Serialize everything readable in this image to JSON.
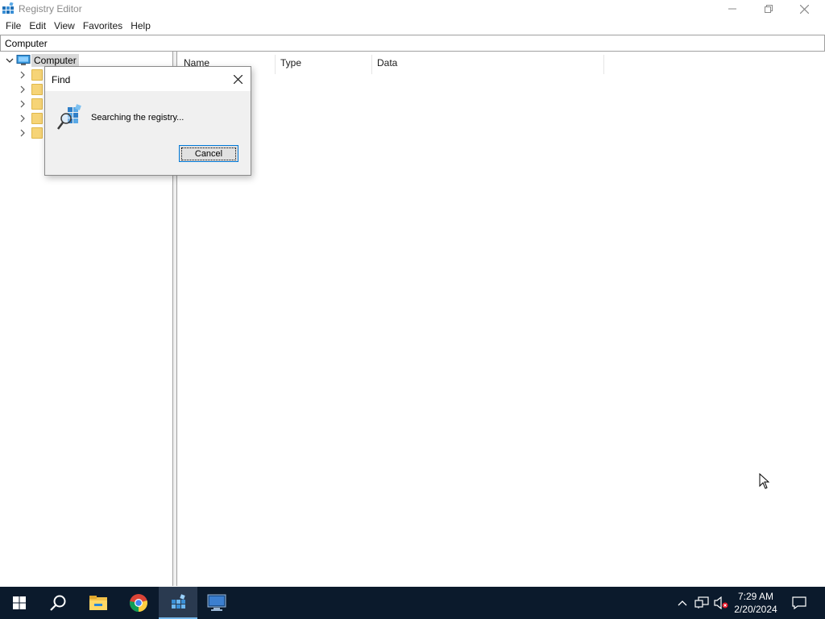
{
  "window": {
    "title": "Registry Editor",
    "icon": "registry-editor-icon"
  },
  "menu": [
    "File",
    "Edit",
    "View",
    "Favorites",
    "Help"
  ],
  "address": {
    "path": "Computer"
  },
  "tree": {
    "root_label": "Computer",
    "root_icon": "computer-icon",
    "child_folder_count": 5
  },
  "list": {
    "columns": [
      "Name",
      "Type",
      "Data"
    ]
  },
  "find_dialog": {
    "title": "Find",
    "message": "Searching the registry...",
    "cancel_label": "Cancel",
    "icon": "search-registry-icon"
  },
  "taskbar": {
    "apps": [
      "start-icon",
      "search-icon",
      "file-explorer-icon",
      "chrome-icon",
      "registry-editor-icon",
      "remote-desktop-icon"
    ],
    "active_app": "registry-editor-icon",
    "time": "7:29 AM",
    "date": "2/20/2024"
  },
  "colors": {
    "taskbar_bg": "#0b1a2c",
    "accent": "#0078d7",
    "folder": "#f6d477",
    "selection": "#d9d9d9"
  }
}
